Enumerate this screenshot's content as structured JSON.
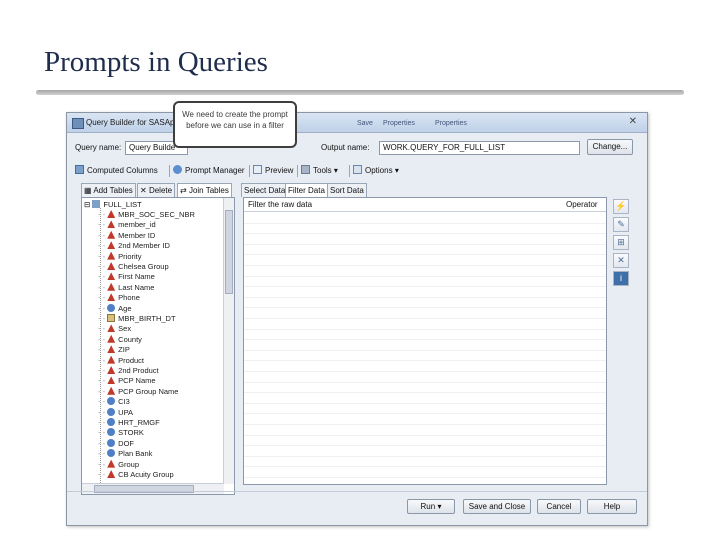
{
  "slide": {
    "title": "Prompts in Queries"
  },
  "window": {
    "title": "Query Builder for SASAp",
    "close_glyph": "✕",
    "menus": [
      "Save",
      "Properties",
      "Properties"
    ]
  },
  "query": {
    "name_label": "Query name:",
    "name_value": "Query Builde",
    "output_label": "Output name:",
    "output_value": "WORK.QUERY_FOR_FULL_LIST",
    "change_label": "Change..."
  },
  "toolbar": {
    "computed_columns": "Computed Columns",
    "prompt_manager": "Prompt Manager",
    "preview": "Preview",
    "tools": "Tools",
    "options": "Options"
  },
  "left_tabs": [
    "Add Tables",
    "Delete",
    "Join Tables"
  ],
  "tree": {
    "root": "FULL_LIST",
    "items": [
      "MBR_SOC_SEC_NBR",
      "member_id",
      "Member ID",
      "2nd Member ID",
      "Priority",
      "Chelsea Group",
      "First Name",
      "Last Name",
      "Phone",
      "Age",
      "MBR_BIRTH_DT",
      "Sex",
      "County",
      "ZIP",
      "Product",
      "2nd Product",
      "PCP Name",
      "PCP Group Name",
      "CI3",
      "UPA",
      "HRT_RMGF",
      "STORK",
      "DOF",
      "Plan Bank",
      "Group",
      "CB Acuity Group"
    ]
  },
  "right_tabs": [
    "Select Data",
    "Filter Data",
    "Sort Data"
  ],
  "filter_grid": {
    "col1": "Filter the raw data",
    "col2": "Operator"
  },
  "bottom_buttons": {
    "run": "Run",
    "save_close": "Save and Close",
    "cancel": "Cancel",
    "help": "Help"
  },
  "callout": {
    "text": "We need to create the prompt before we can use in a filter"
  },
  "colors": {
    "title": "#1f2d4d",
    "window_bg": "#e8edf4",
    "accent": "#3e6fa8",
    "field_icon": "#c0392b"
  }
}
